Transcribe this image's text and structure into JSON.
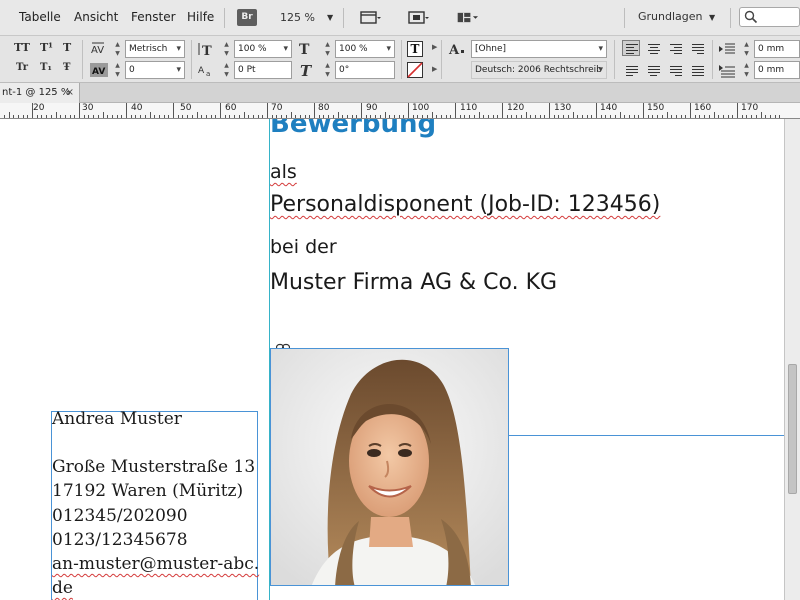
{
  "menubar": {
    "items": [
      "Tabelle",
      "Ansicht",
      "Fenster",
      "Hilfe"
    ],
    "bridge_badge": "Br",
    "zoom": "125 %",
    "workspace": "Grundlagen"
  },
  "control_panel": {
    "char_glyphs_row1": [
      "TT",
      "T¹",
      "T"
    ],
    "char_glyphs_row2": [
      "Tr",
      "T₁",
      "Ŧ"
    ],
    "kerning_method": "Metrisch",
    "tracking": "0",
    "vertical_scale": "100 %",
    "horizontal_scale": "100 %",
    "baseline_shift": "0 Pt",
    "skew": "0°",
    "char_style": "[Ohne]",
    "language": "Deutsch: 2006 Rechtschreib",
    "indent_left": "0 mm",
    "indent_first": "0 mm"
  },
  "doc_tab": {
    "label": "nt-1 @ 125 %",
    "close": "×"
  },
  "ruler": {
    "labels": [
      "20",
      "30",
      "40",
      "50",
      "60",
      "70",
      "80",
      "90",
      "100",
      "110",
      "120",
      "130",
      "140",
      "150",
      "160",
      "170"
    ]
  },
  "document": {
    "heading": "Bewerbung",
    "line_als": "als",
    "position": "Personaldisponent (Job-ID: 123456)",
    "line_bei": "bei der",
    "company": "Muster Firma AG & Co. KG",
    "address": {
      "name": "Andrea Muster",
      "street": "Große Musterstraße 13",
      "city": "17192 Waren (Müritz)",
      "phone": " 012345/202090",
      "mobile": "0123/12345678",
      "email_1": " an-muster@muster-abc.",
      "email_2": "de"
    }
  },
  "colors": {
    "heading": "#1e7fc0",
    "frame": "#4a93d6",
    "guide": "#36b3c8"
  }
}
